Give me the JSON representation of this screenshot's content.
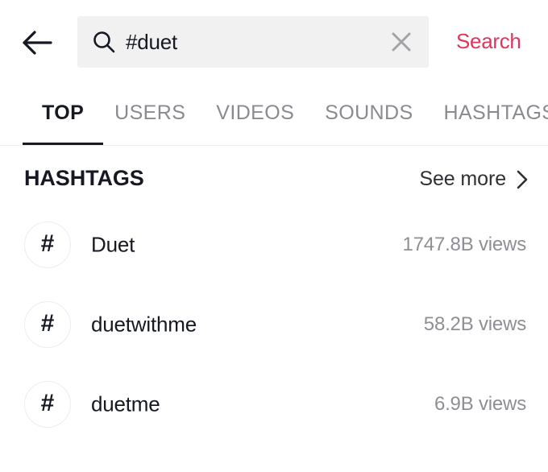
{
  "header": {
    "back_icon": "arrow-left-icon",
    "search": {
      "icon": "search-icon",
      "value": "#duet",
      "placeholder": "Search",
      "clear_icon": "close-icon"
    },
    "search_action_label": "Search",
    "accent_color": "#e0365c"
  },
  "tabs": {
    "active_index": 0,
    "items": [
      {
        "label": "TOP"
      },
      {
        "label": "USERS"
      },
      {
        "label": "VIDEOS"
      },
      {
        "label": "SOUNDS"
      },
      {
        "label": "HASHTAGS"
      }
    ]
  },
  "section": {
    "title": "HASHTAGS",
    "see_more_label": "See more",
    "see_more_icon": "chevron-right-icon"
  },
  "hashtags": [
    {
      "glyph": "#",
      "name": "Duet",
      "views": "1747.8B views"
    },
    {
      "glyph": "#",
      "name": "duetwithme",
      "views": "58.2B views"
    },
    {
      "glyph": "#",
      "name": "duetme",
      "views": "6.9B views"
    }
  ]
}
